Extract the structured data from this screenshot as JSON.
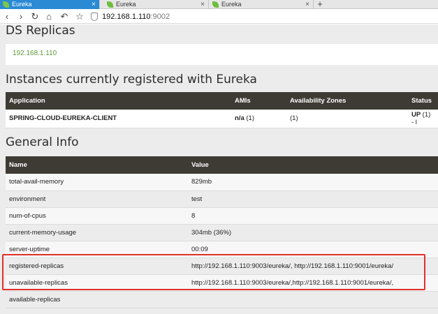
{
  "browser": {
    "tabs": [
      {
        "label": "Eureka",
        "active": true
      },
      {
        "label": "Eureka",
        "active": false
      },
      {
        "label": "Eureka",
        "active": false
      }
    ],
    "new_tab": "+",
    "close": "×",
    "url_host": "192.168.1.110",
    "url_port": ":9002"
  },
  "replicas": {
    "heading": "DS Replicas",
    "items": [
      "192.168.1.110"
    ]
  },
  "instances": {
    "heading": "Instances currently registered with Eureka",
    "columns": [
      "Application",
      "AMIs",
      "Availability Zones",
      "Status"
    ],
    "rows": [
      {
        "application": "SPRING-CLOUD-EUREKA-CLIENT",
        "amis": "n/a",
        "amis_count": "(1)",
        "zones": "(1)",
        "status": "UP",
        "status_count": "(1) - l"
      }
    ]
  },
  "general": {
    "heading": "General Info",
    "columns": [
      "Name",
      "Value"
    ],
    "rows": [
      {
        "name": "total-avail-memory",
        "value": "829mb"
      },
      {
        "name": "environment",
        "value": "test"
      },
      {
        "name": "num-of-cpus",
        "value": "8"
      },
      {
        "name": "current-memory-usage",
        "value": "304mb (36%)"
      },
      {
        "name": "server-uptime",
        "value": "00:09"
      },
      {
        "name": "registered-replicas",
        "value": "http://192.168.1.110:9003/eureka/, http://192.168.1.110:9001/eureka/"
      },
      {
        "name": "unavailable-replicas",
        "value": "http://192.168.1.110:9003/eureka/,http://192.168.1.110:9001/eureka/,"
      },
      {
        "name": "available-replicas",
        "value": ""
      }
    ]
  },
  "colors": {
    "highlight": "#e0302a",
    "link": "#5c9a3a",
    "header_bg": "#3e3a34",
    "tab_active": "#2a8ad4"
  }
}
